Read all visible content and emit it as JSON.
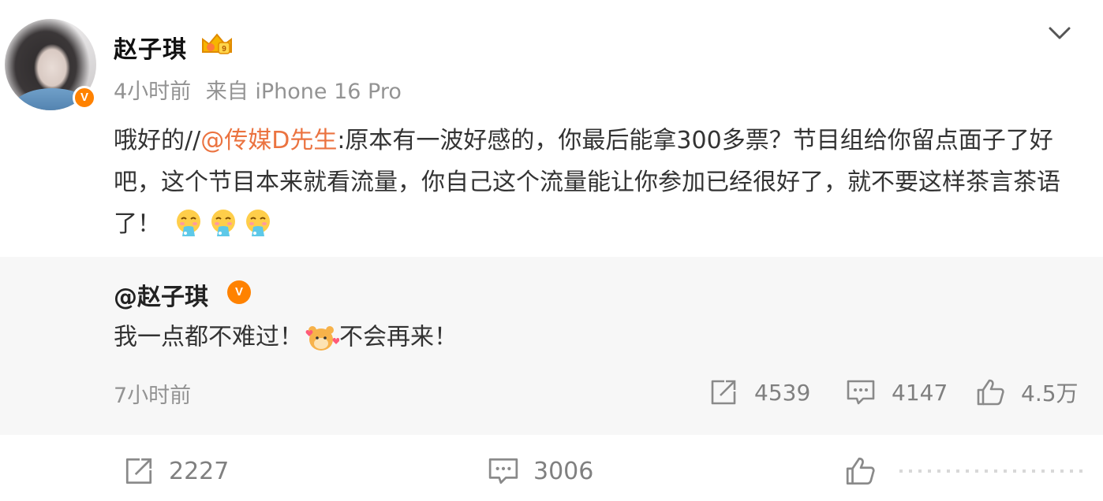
{
  "post": {
    "author": "赵子琪",
    "avatar_badge": "V",
    "time": "4小时前",
    "source": "来自 iPhone 16 Pro",
    "text_before": "哦好的//",
    "mention": "@传媒D先生",
    "text_after": ":原本有一波好感的，你最后能拿300多票？节目组给你留点面子了好吧，这个节目本来就看流量，你自己这个流量能让你参加已经很好了，就不要这样茶言茶语了！",
    "emojis": [
      "puke-emoji",
      "puke-emoji",
      "puke-emoji"
    ]
  },
  "quoted": {
    "author": "@赵子琪",
    "badge": "V",
    "text_part1": "我一点都不难过！",
    "text_part2": "不会再来！",
    "time": "7小时前",
    "reposts": "4539",
    "comments": "4147",
    "likes": "4.5万"
  },
  "actions": {
    "reposts": "2227",
    "comments": "3006"
  },
  "colors": {
    "accent": "#ff8200",
    "mention": "#eb7340",
    "muted": "#939393",
    "quote_bg": "#f7f7f7"
  }
}
